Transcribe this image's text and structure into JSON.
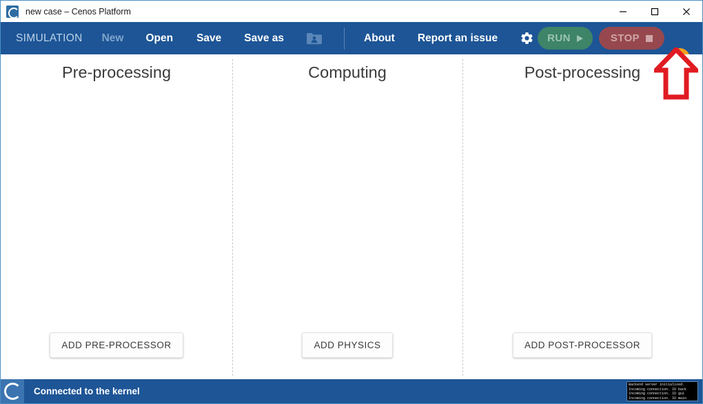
{
  "window": {
    "title": "new case – Cenos Platform",
    "app_icon": "cenos-logo-icon",
    "controls": {
      "minimize": "minimize-icon",
      "maximize": "maximize-icon",
      "close": "close-icon"
    }
  },
  "toolbar": {
    "simulation_label": "SIMULATION",
    "new_label": "New",
    "open_label": "Open",
    "save_label": "Save",
    "save_as_label": "Save as",
    "folder_icon": "user-folder-icon",
    "about_label": "About",
    "report_label": "Report an issue",
    "gear_icon": "gear-icon",
    "run_label": "RUN",
    "run_icon": "play-triangle-icon",
    "stop_label": "STOP",
    "stop_icon": "stop-square-icon",
    "help_label": "?",
    "colors": {
      "bar": "#1d5596",
      "run": "#3d8468",
      "run_text": "#9cc4b2",
      "stop": "#97484e",
      "stop_text": "#cfa5a8",
      "help": "#f0a020"
    }
  },
  "main": {
    "columns": [
      {
        "title": "Pre-processing",
        "button": "ADD PRE-PROCESSOR"
      },
      {
        "title": "Computing",
        "button": "ADD PHYSICS"
      },
      {
        "title": "Post-processing",
        "button": "ADD POST-PROCESSOR"
      }
    ]
  },
  "annotation": {
    "arrow": "up-arrow-annotation",
    "color": "#e11b22"
  },
  "status": {
    "logo": "cenos-logo-icon",
    "text": "Connected to the kernel",
    "console_lines": [
      "Backend server initialized.",
      "Incoming connection. ID back",
      "Incoming connection. ID gui",
      "Incoming connection. ID main"
    ]
  }
}
